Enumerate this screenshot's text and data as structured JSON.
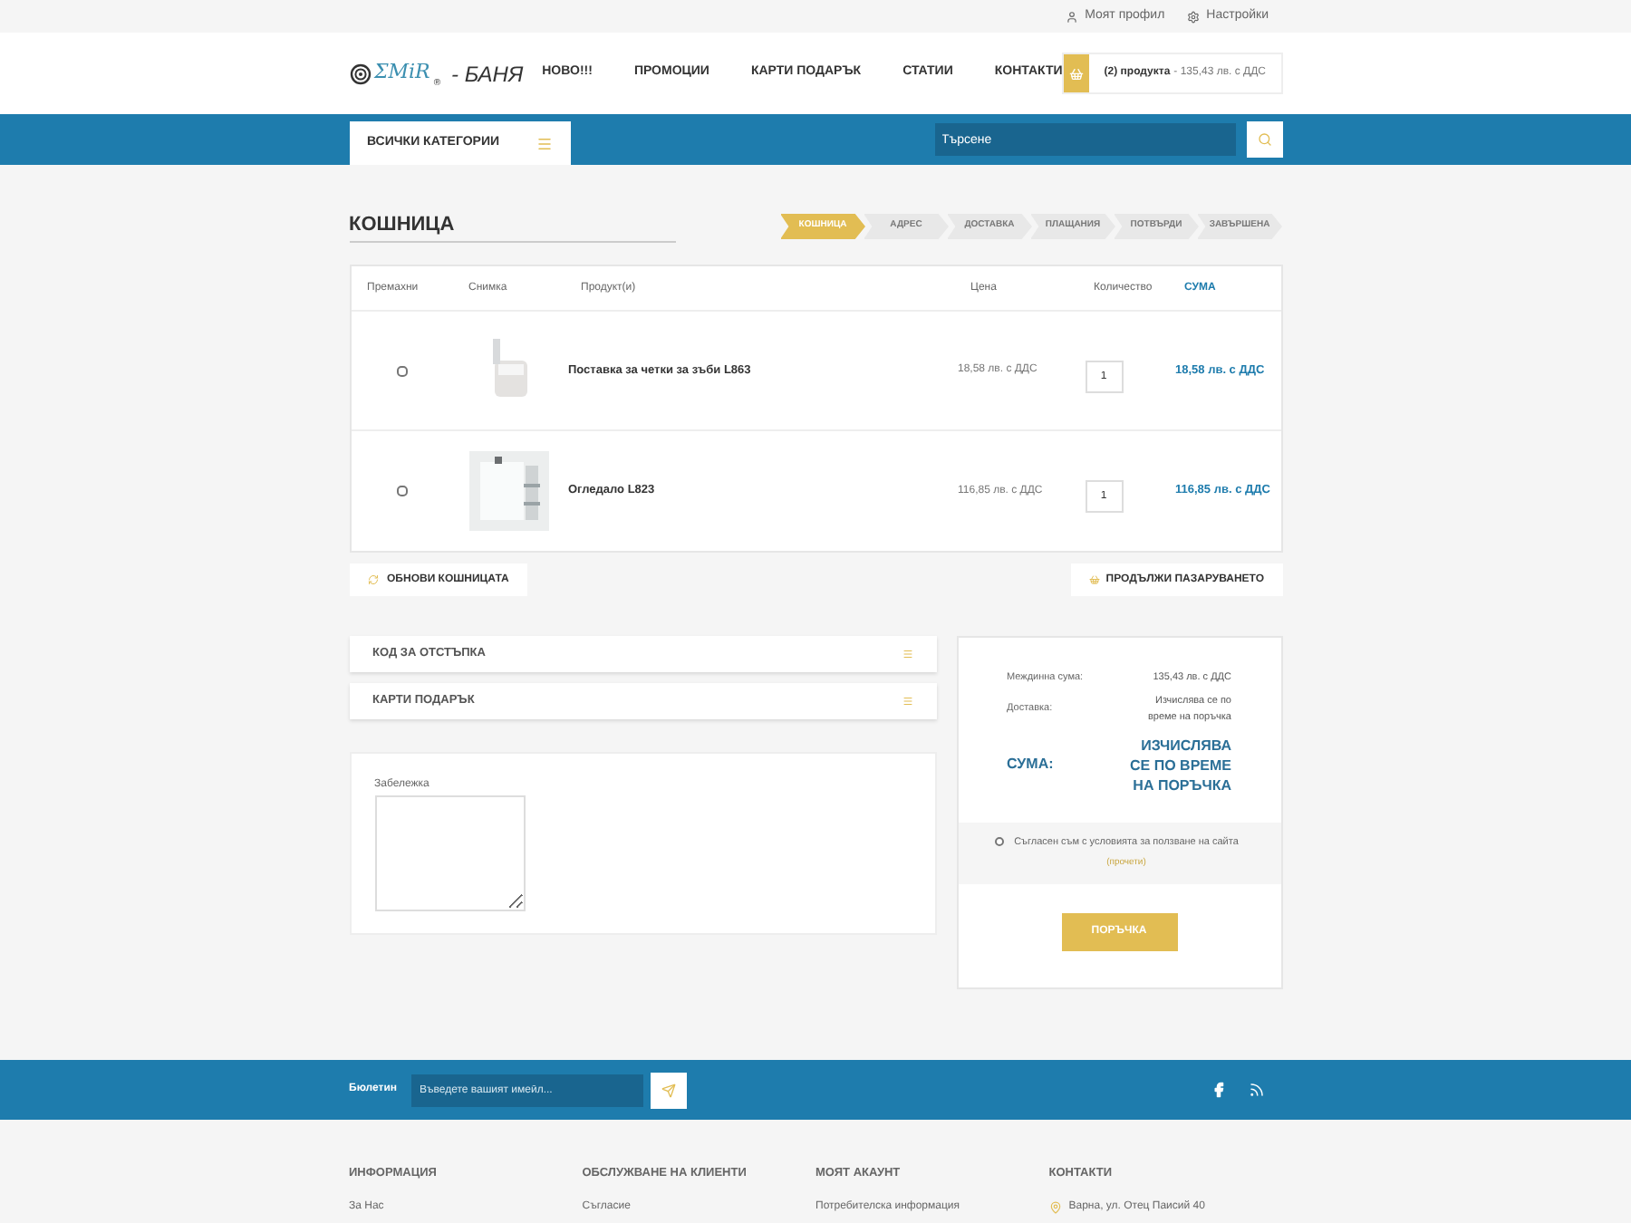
{
  "top_links": [
    {
      "label": "Моят профил",
      "kind": "user"
    },
    {
      "label": "Настройки",
      "kind": "gear"
    }
  ],
  "logo": {
    "mark": "ΣMiR",
    "registered": "®",
    "suffix": "- БАНЯ"
  },
  "nav": [
    "НОВО!!!",
    "ПРОМОЦИИ",
    "КАРТИ ПОДАРЪК",
    "СТАТИИ",
    "КОНТАКТИ"
  ],
  "cart_summary": {
    "count": "(2) продукта",
    "total": "- 135,43 лв. с ДДС"
  },
  "categories_button": "ВСИЧКИ КАТЕГОРИИ",
  "search": {
    "placeholder": "Търсене"
  },
  "page_title": "КОШНИЦА",
  "steps": [
    {
      "label": "КОШНИЦА",
      "selected": true
    },
    {
      "label": "АДРЕС",
      "selected": false
    },
    {
      "label": "ДОСТАВКА",
      "selected": false
    },
    {
      "label": "ПЛАЩАНИЯ",
      "selected": false
    },
    {
      "label": "ПОТВЪРДИ",
      "selected": false
    },
    {
      "label": "ЗАВЪРШЕНА",
      "selected": false
    }
  ],
  "table": {
    "columns": [
      "Премахни",
      "Снимка",
      "Продукт(и)",
      "Цена",
      "Количество",
      "СУМА"
    ],
    "rows": [
      {
        "remove": false,
        "name": "Поставка за четки за зъби L863",
        "price": "18,58 лв. с ДДС",
        "quantity": "1",
        "total": "18,58 лв. с ДДС"
      },
      {
        "remove": false,
        "name": "Огледало L823",
        "price": "116,85 лв. с ДДС",
        "quantity": "1",
        "total": "116,85 лв. с ДДС"
      }
    ]
  },
  "update_button": "ОБНОВИ КОШНИЦАТА",
  "continue_button": "ПРОДЪЛЖИ ПАЗАРУВАНЕТО",
  "accordions": [
    {
      "title": "КОД ЗА ОТСТЪПКА"
    },
    {
      "title": "КАРТИ ПОДАРЪК"
    }
  ],
  "note": {
    "label": "Забележка"
  },
  "summary": {
    "rows": [
      {
        "label": "Междинна сума:",
        "value": "135,43 лв. с ДДС"
      },
      {
        "label": "Доставка:",
        "value": "Изчислява се по време на поръчка"
      }
    ],
    "total_label": "СУМА:",
    "total_value": "ИЗЧИСЛЯВА СЕ ПО ВРЕМЕ НА ПОРЪЧКА"
  },
  "terms": {
    "checked": false,
    "text": "Съгласен съм с условията за ползване на сайта",
    "link": "(прочети)"
  },
  "order_button": "ПОРЪЧКА",
  "newsletter": {
    "label": "Бюлетин",
    "placeholder": "Въведете вашият имейл..."
  },
  "footer_columns": [
    {
      "heading": "ИНФОРМАЦИЯ",
      "items": [
        {
          "label": "За Нас"
        }
      ]
    },
    {
      "heading": "ОБСЛУЖВАНЕ НА КЛИЕНТИ",
      "items": [
        {
          "label": "Съгласие"
        }
      ]
    },
    {
      "heading": "МОЯТ АКАУНТ",
      "items": [
        {
          "label": "Потребителска информация"
        }
      ]
    },
    {
      "heading": "КОНТАКТИ",
      "items": [
        {
          "label": "Варна, ул. Отец Паисий 40",
          "kind": "location"
        }
      ]
    }
  ]
}
